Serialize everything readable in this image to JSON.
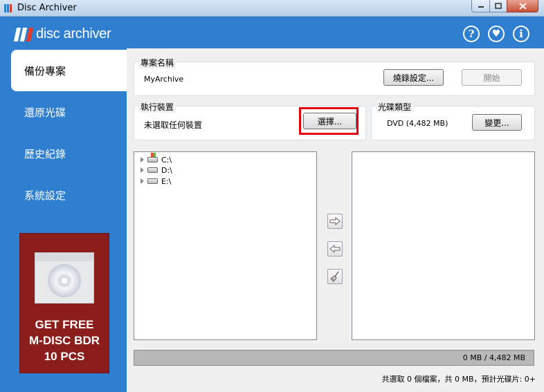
{
  "window": {
    "title": "Disc Archiver"
  },
  "header": {
    "logo_text": "disc archiver",
    "help_icon": "?",
    "favorite_icon": "♥",
    "info_icon": "i"
  },
  "sidebar": {
    "items": [
      {
        "label": "備份專案",
        "active": true
      },
      {
        "label": "還原光碟",
        "active": false
      },
      {
        "label": "歷史紀錄",
        "active": false
      },
      {
        "label": "系統設定",
        "active": false
      }
    ],
    "ad": {
      "text": "GET FREE\nM-DISC BDR\n10 PCS",
      "line1": "GET FREE",
      "line2": "M-DISC BDR",
      "line3": "10 PCS"
    }
  },
  "project": {
    "label": "專案名稱",
    "name": "MyArchive",
    "burn_settings_label": "燒錄設定...",
    "start_label": "開始"
  },
  "device": {
    "label": "執行裝置",
    "value": "未選取任何裝置",
    "select_label": "選擇..."
  },
  "disc_type": {
    "label": "光碟類型",
    "value": "DVD (4,482 MB)",
    "change_label": "變更..."
  },
  "tree": {
    "items": [
      {
        "label": "C:\\",
        "icon": "system-drive-icon"
      },
      {
        "label": "D:\\",
        "icon": "drive-icon"
      },
      {
        "label": "E:\\",
        "icon": "drive-icon"
      }
    ]
  },
  "transfer": {
    "add_icon": "arrow-right-icon",
    "remove_icon": "arrow-left-icon",
    "clear_icon": "broom-icon"
  },
  "progress": {
    "text": "0 MB / 4,482 MB",
    "fraction": 0
  },
  "status": {
    "text": "共選取 0 個檔案，共 0 MB，預計光碟片: 0+"
  },
  "colors": {
    "header_blue": "#2f7fd0",
    "highlight_red": "#e3000f",
    "ad_red": "#8b1d1a"
  }
}
